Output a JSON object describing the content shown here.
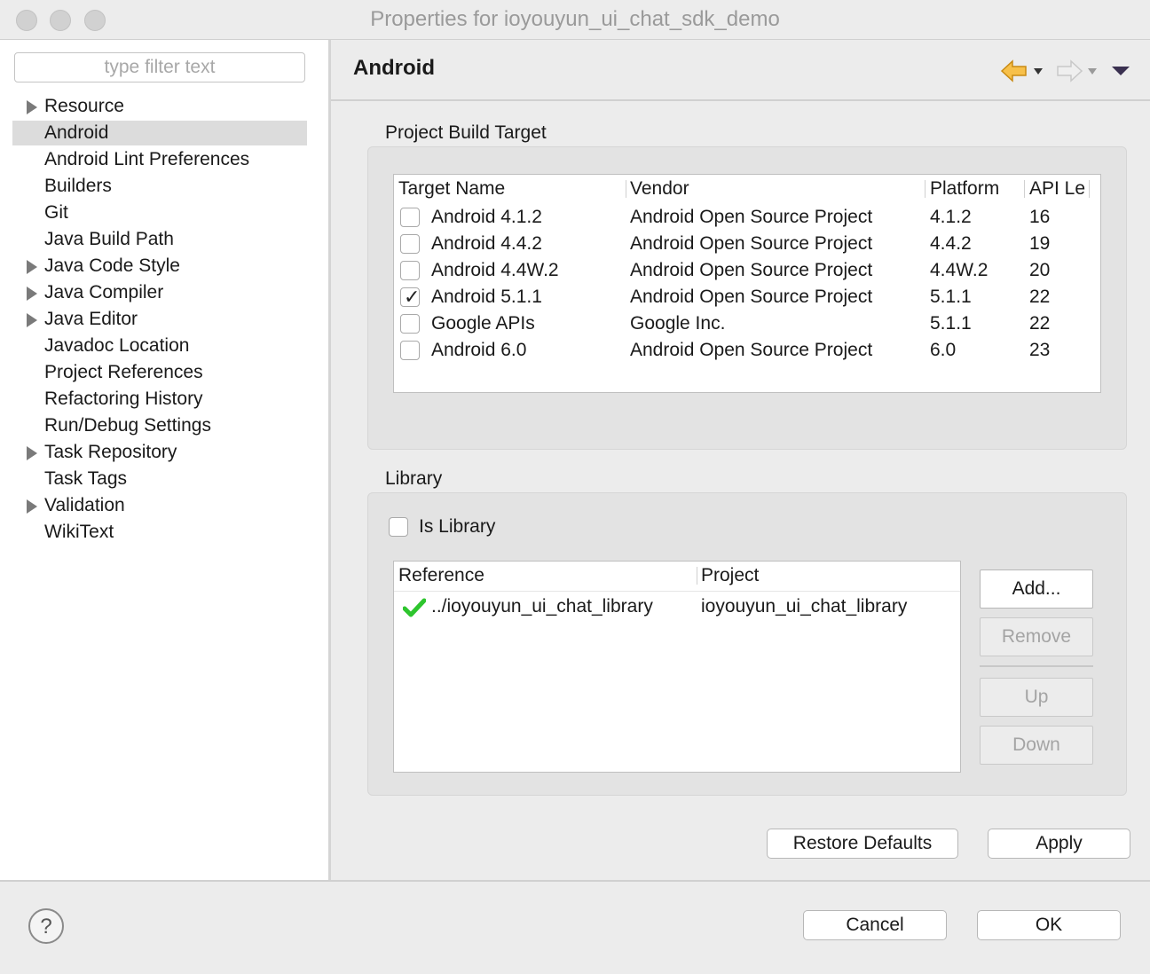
{
  "window": {
    "title": "Properties for ioyouyun_ui_chat_sdk_demo"
  },
  "sidebar": {
    "filter_placeholder": "type filter text",
    "items": [
      {
        "label": "Resource",
        "expandable": true,
        "selected": false
      },
      {
        "label": "Android",
        "expandable": false,
        "selected": true
      },
      {
        "label": "Android Lint Preferences",
        "expandable": false,
        "selected": false
      },
      {
        "label": "Builders",
        "expandable": false,
        "selected": false
      },
      {
        "label": "Git",
        "expandable": false,
        "selected": false
      },
      {
        "label": "Java Build Path",
        "expandable": false,
        "selected": false
      },
      {
        "label": "Java Code Style",
        "expandable": true,
        "selected": false
      },
      {
        "label": "Java Compiler",
        "expandable": true,
        "selected": false
      },
      {
        "label": "Java Editor",
        "expandable": true,
        "selected": false
      },
      {
        "label": "Javadoc Location",
        "expandable": false,
        "selected": false
      },
      {
        "label": "Project References",
        "expandable": false,
        "selected": false
      },
      {
        "label": "Refactoring History",
        "expandable": false,
        "selected": false
      },
      {
        "label": "Run/Debug Settings",
        "expandable": false,
        "selected": false
      },
      {
        "label": "Task Repository",
        "expandable": true,
        "selected": false
      },
      {
        "label": "Task Tags",
        "expandable": false,
        "selected": false
      },
      {
        "label": "Validation",
        "expandable": true,
        "selected": false
      },
      {
        "label": "WikiText",
        "expandable": false,
        "selected": false
      }
    ]
  },
  "page": {
    "title": "Android"
  },
  "build_target": {
    "group_label": "Project Build Target",
    "columns": [
      "Target Name",
      "Vendor",
      "Platform",
      "API Le"
    ],
    "rows": [
      {
        "name": "Android 4.1.2",
        "vendor": "Android Open Source Project",
        "platform": "4.1.2",
        "api": "16",
        "checked": false
      },
      {
        "name": "Android 4.4.2",
        "vendor": "Android Open Source Project",
        "platform": "4.4.2",
        "api": "19",
        "checked": false
      },
      {
        "name": "Android 4.4W.2",
        "vendor": "Android Open Source Project",
        "platform": "4.4W.2",
        "api": "20",
        "checked": false
      },
      {
        "name": "Android 5.1.1",
        "vendor": "Android Open Source Project",
        "platform": "5.1.1",
        "api": "22",
        "checked": true
      },
      {
        "name": "Google APIs",
        "vendor": "Google Inc.",
        "platform": "5.1.1",
        "api": "22",
        "checked": false
      },
      {
        "name": "Android 6.0",
        "vendor": "Android Open Source Project",
        "platform": "6.0",
        "api": "23",
        "checked": false
      }
    ]
  },
  "library": {
    "group_label": "Library",
    "is_library_label": "Is Library",
    "is_library_checked": false,
    "columns": [
      "Reference",
      "Project"
    ],
    "rows": [
      {
        "reference": "../ioyouyun_ui_chat_library",
        "project": "ioyouyun_ui_chat_library",
        "status_icon": "green-check-icon"
      }
    ],
    "buttons": {
      "add": "Add...",
      "remove": "Remove",
      "up": "Up",
      "down": "Down"
    }
  },
  "actions": {
    "restore_defaults": "Restore Defaults",
    "apply": "Apply"
  },
  "dialog_buttons": {
    "cancel": "Cancel",
    "ok": "OK"
  },
  "colors": {
    "check_green": "#2ec52e",
    "selection": "#dcdcdc",
    "back_arrow": "#f2a52b"
  }
}
